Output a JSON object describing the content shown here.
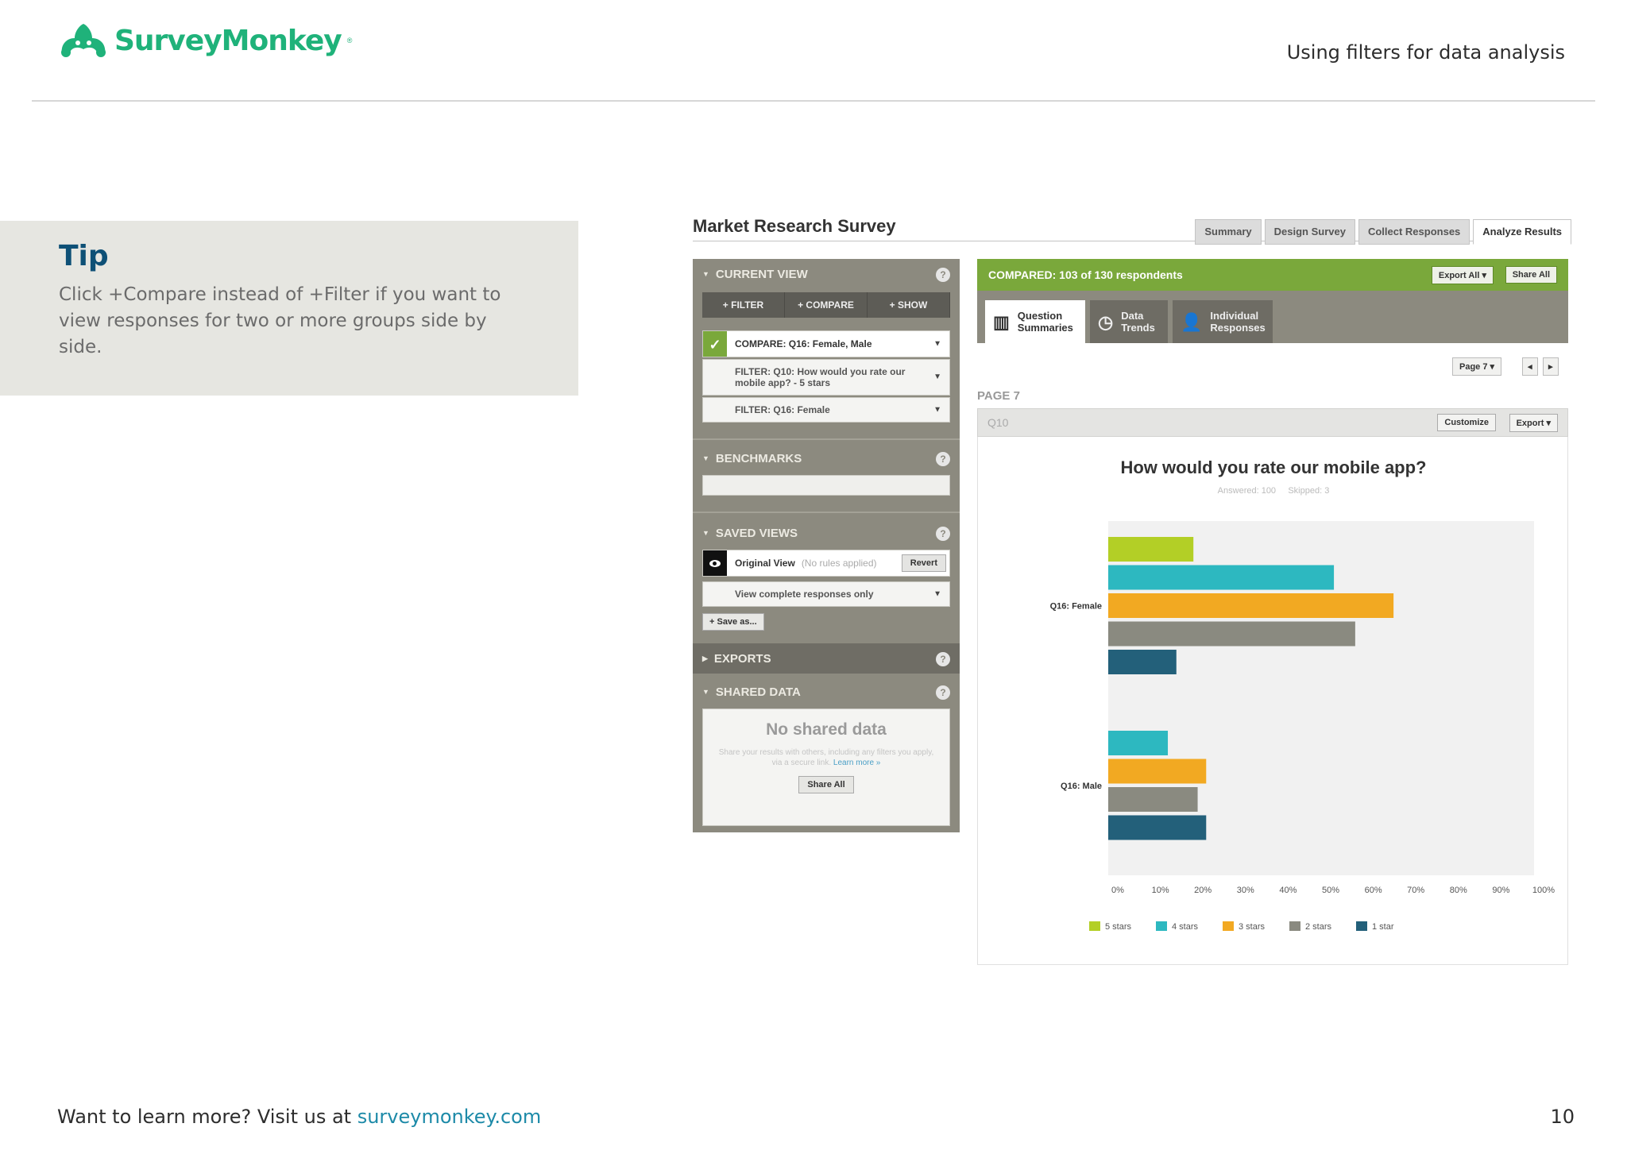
{
  "brand": {
    "name": "SurveyMonkey",
    "reg": "®",
    "color": "#1fb27a"
  },
  "header": {
    "doc_title": "Using filters for data analysis"
  },
  "tip": {
    "title": "Tip",
    "text": "Click +Compare instead of +Filter if you want to view responses for two or more groups side by side."
  },
  "screenshot": {
    "survey_title": "Market Research Survey",
    "tabs": [
      {
        "label": "Summary",
        "active": false
      },
      {
        "label": "Design Survey",
        "active": false
      },
      {
        "label": "Collect Responses",
        "active": false
      },
      {
        "label": "Analyze Results",
        "active": true
      }
    ],
    "sidebar": {
      "current_view": {
        "title": "CURRENT VIEW",
        "buttons": [
          "+ FILTER",
          "+ COMPARE",
          "+ SHOW"
        ],
        "rules": [
          "COMPARE: Q16: Female, Male",
          "FILTER: Q10: How would you rate our mobile app? - 5 stars",
          "FILTER: Q16: Female"
        ]
      },
      "benchmarks": {
        "title": "BENCHMARKS"
      },
      "saved_views": {
        "title": "SAVED VIEWS",
        "original_view": "Original View",
        "original_note": "(No rules applied)",
        "revert": "Revert",
        "complete_only": "View complete responses only",
        "save_as": "+ Save as..."
      },
      "exports": {
        "title": "EXPORTS"
      },
      "shared_data": {
        "title": "SHARED DATA",
        "empty": "No shared data",
        "description": "Share your results with others, including any filters you apply, via a secure link.",
        "learn_more": "Learn more »",
        "share_all": "Share All"
      },
      "help_icon": "?"
    },
    "results": {
      "compared_text": "COMPARED: 103 of 130 respondents",
      "export_all": "Export All ▾",
      "share_all": "Share All",
      "view_tabs": [
        {
          "label": "Question Summaries",
          "icon": "bar-chart-icon",
          "active": true
        },
        {
          "label": "Data Trends",
          "icon": "clock-icon",
          "active": false
        },
        {
          "label": "Individual Responses",
          "icon": "person-icon",
          "active": false
        }
      ],
      "page_select": "Page 7 ▾",
      "prev": "◂",
      "next": "▸",
      "page_label": "PAGE 7",
      "question_id": "Q10",
      "customize": "Customize",
      "export": "Export ▾",
      "question_title": "How would you rate our mobile app?",
      "answered": "Answered: 100",
      "skipped": "Skipped: 3"
    }
  },
  "chart_data": {
    "type": "bar",
    "orientation": "horizontal",
    "categories": [
      "Q16: Female",
      "Q16: Male"
    ],
    "series": [
      {
        "name": "5 stars",
        "color": "#b3cf26",
        "values": [
          20,
          0
        ]
      },
      {
        "name": "4 stars",
        "color": "#2db8c0",
        "values": [
          53,
          14
        ]
      },
      {
        "name": "3 stars",
        "color": "#f2a922",
        "values": [
          67,
          23
        ]
      },
      {
        "name": "2 stars",
        "color": "#8a8a80",
        "values": [
          58,
          21
        ]
      },
      {
        "name": "1 star",
        "color": "#23607a",
        "values": [
          16,
          23
        ]
      }
    ],
    "x_ticks": [
      "0%",
      "10%",
      "20%",
      "30%",
      "40%",
      "50%",
      "60%",
      "70%",
      "80%",
      "90%",
      "100%"
    ],
    "xlim": [
      0,
      100
    ],
    "grid": false,
    "legend": "bottom"
  },
  "footer": {
    "text": "Want to learn more? Visit us at ",
    "link": "surveymonkey.com",
    "page_number": "10"
  }
}
